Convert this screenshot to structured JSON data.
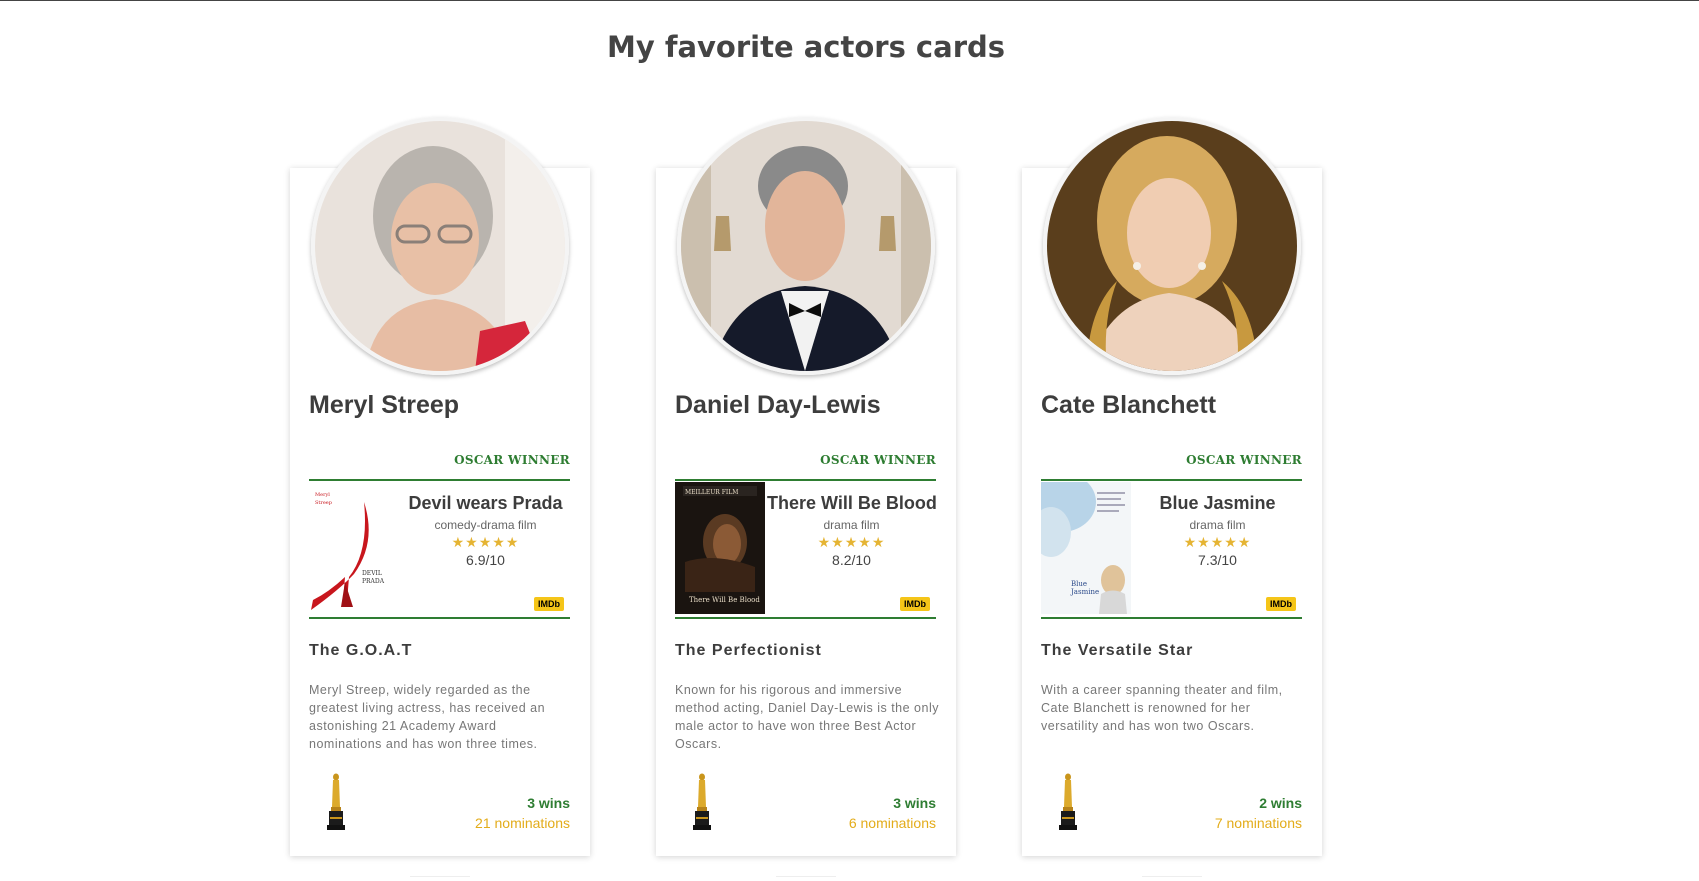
{
  "page": {
    "title": "My favorite actors cards"
  },
  "cards": [
    {
      "name": "Meryl Streep",
      "badge": "OSCAR WINNER",
      "film": {
        "title": "Devil wears Prada",
        "genre": "comedy-drama film",
        "stars": "★★★★★",
        "rating": "6.9/10",
        "imdb": "IMDb"
      },
      "subtitle": "The G.O.A.T",
      "bio": "Meryl Streep, widely regarded as the greatest living actress, has received an astonishing 21 Academy Award nominations and has won three times.",
      "wins": "3 wins",
      "nominations": "21 nominations"
    },
    {
      "name": "Daniel Day-Lewis",
      "badge": "OSCAR WINNER",
      "film": {
        "title": "There Will Be Blood",
        "genre": "drama film",
        "stars": "★★★★★",
        "rating": "8.2/10",
        "imdb": "IMDb"
      },
      "subtitle": "The Perfectionist",
      "bio": "Known for his rigorous and immersive method acting, Daniel Day-Lewis is the only male actor to have won three Best Actor Oscars.",
      "wins": "3 wins",
      "nominations": "6 nominations"
    },
    {
      "name": "Cate Blanchett",
      "badge": "OSCAR WINNER",
      "film": {
        "title": "Blue Jasmine",
        "genre": "drama film",
        "stars": "★★★★★",
        "rating": "7.3/10",
        "imdb": "IMDb"
      },
      "subtitle": "The Versatile Star",
      "bio": "With a career spanning theater and film, Cate Blanchett is renowned for her versatility and has won two Oscars.",
      "wins": "2 wins",
      "nominations": "7 nominations"
    }
  ]
}
